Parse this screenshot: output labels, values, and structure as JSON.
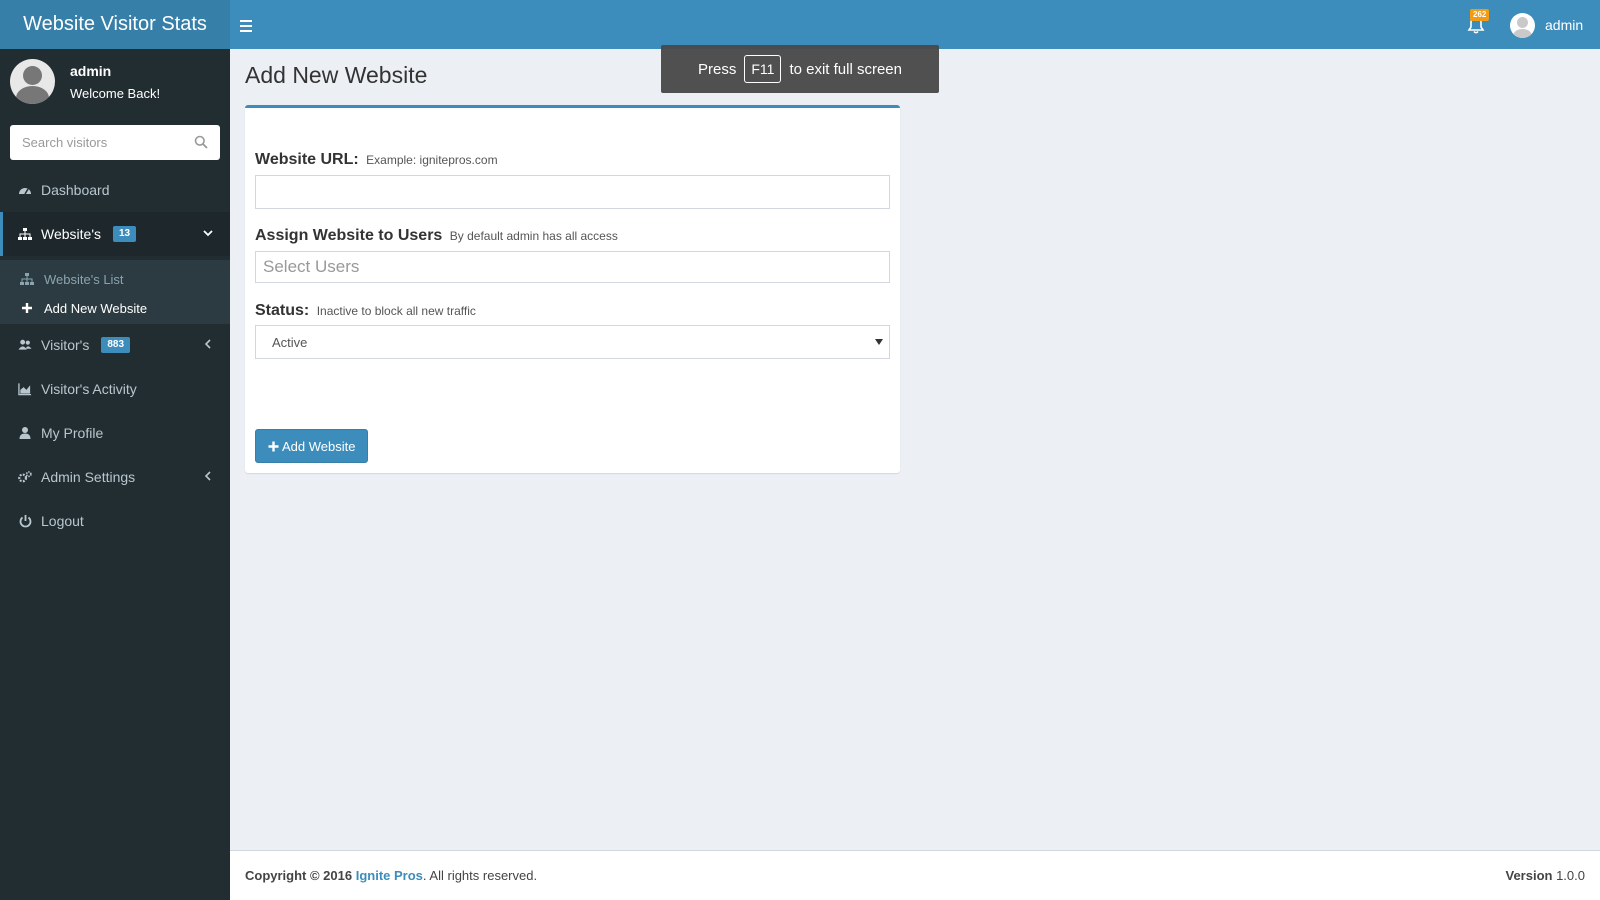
{
  "app": {
    "title": "Website Visitor Stats"
  },
  "header": {
    "notification_count": "262",
    "user_name": "admin"
  },
  "sidebar": {
    "user_name": "admin",
    "welcome": "Welcome Back!",
    "search_placeholder": "Search visitors",
    "items": [
      {
        "label": "Dashboard",
        "icon": "dashboard-icon"
      },
      {
        "label": "Website's",
        "icon": "sitemap-icon",
        "badge": "13",
        "expanded": true
      },
      {
        "label": "Visitor's",
        "icon": "users-icon",
        "badge": "883"
      },
      {
        "label": "Visitor's Activity",
        "icon": "area-chart-icon"
      },
      {
        "label": "My Profile",
        "icon": "user-icon"
      },
      {
        "label": "Admin Settings",
        "icon": "gears-icon"
      },
      {
        "label": "Logout",
        "icon": "power-icon"
      }
    ],
    "submenu": [
      {
        "label": "Website's List",
        "icon": "sitemap-icon"
      },
      {
        "label": "Add New Website",
        "icon": "plus-icon",
        "active": true
      }
    ]
  },
  "toast": {
    "press": "Press",
    "key": "F11",
    "rest": "to exit full screen"
  },
  "page": {
    "title": "Add New Website"
  },
  "form": {
    "url_label": "Website URL:",
    "url_hint": "Example: ignitepros.com",
    "url_value": "",
    "assign_label": "Assign Website to Users",
    "assign_hint": "By default admin has all access",
    "assign_placeholder": "Select Users",
    "status_label": "Status:",
    "status_hint": "Inactive to block all new traffic",
    "status_value": "Active",
    "submit_label": "Add Website"
  },
  "footer": {
    "copyright_prefix": "Copyright © 2016",
    "company": "Ignite Pros",
    "copyright_suffix": ". All rights reserved.",
    "version_label": "Version",
    "version_value": "1.0.0"
  },
  "colors": {
    "header": "#3c8dbc",
    "logo_bg": "#367fa9",
    "sidebar": "#222d32",
    "content_bg": "#ecf0f5",
    "badge": "#3c8dbc",
    "notification_badge": "#f39c12"
  }
}
